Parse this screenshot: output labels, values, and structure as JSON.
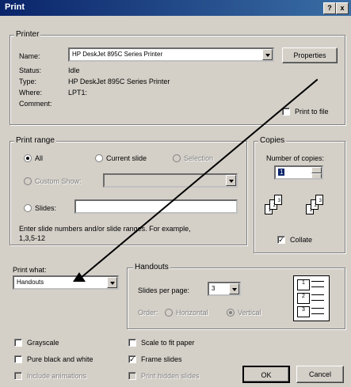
{
  "window": {
    "title": "Print",
    "help_btn": "?",
    "close_btn": "x"
  },
  "printer": {
    "legend": "Printer",
    "name_label": "Name:",
    "name_value": "HP DeskJet 895C Series Printer",
    "properties_label": "Properties",
    "status_label": "Status:",
    "status_value": "Idle",
    "type_label": "Type:",
    "type_value": "HP DeskJet 895C Series Printer",
    "where_label": "Where:",
    "where_value": "LPT1:",
    "comment_label": "Comment:",
    "print_to_file_label": "Print to file"
  },
  "print_range": {
    "legend": "Print range",
    "all_label": "All",
    "current_slide_label": "Current slide",
    "selection_label": "Selection",
    "custom_show_label": "Custom Show:",
    "slides_label": "Slides:",
    "hint": "Enter slide numbers and/or slide ranges. For example,",
    "hint2": "1,3,5-12"
  },
  "copies": {
    "legend": "Copies",
    "number_label": "Number of copies:",
    "number_value": "1",
    "collate_label": "Collate",
    "pages_a": [
      "1",
      "2",
      "3"
    ],
    "pages_b": [
      "1",
      "2",
      "3"
    ]
  },
  "print_what": {
    "label": "Print what:",
    "value": "Handouts"
  },
  "handouts": {
    "legend": "Handouts",
    "slides_per_page_label": "Slides per page:",
    "slides_per_page_value": "3",
    "order_label": "Order:",
    "horizontal_label": "Horizontal",
    "vertical_label": "Vertical",
    "preview": [
      "1",
      "2",
      "3"
    ]
  },
  "options": {
    "grayscale": "Grayscale",
    "pure_bw": "Pure black and white",
    "include_animations": "Include animations",
    "scale_to_fit": "Scale to fit paper",
    "frame_slides": "Frame slides",
    "print_hidden": "Print hidden slides"
  },
  "buttons": {
    "ok": "OK",
    "cancel": "Cancel"
  }
}
